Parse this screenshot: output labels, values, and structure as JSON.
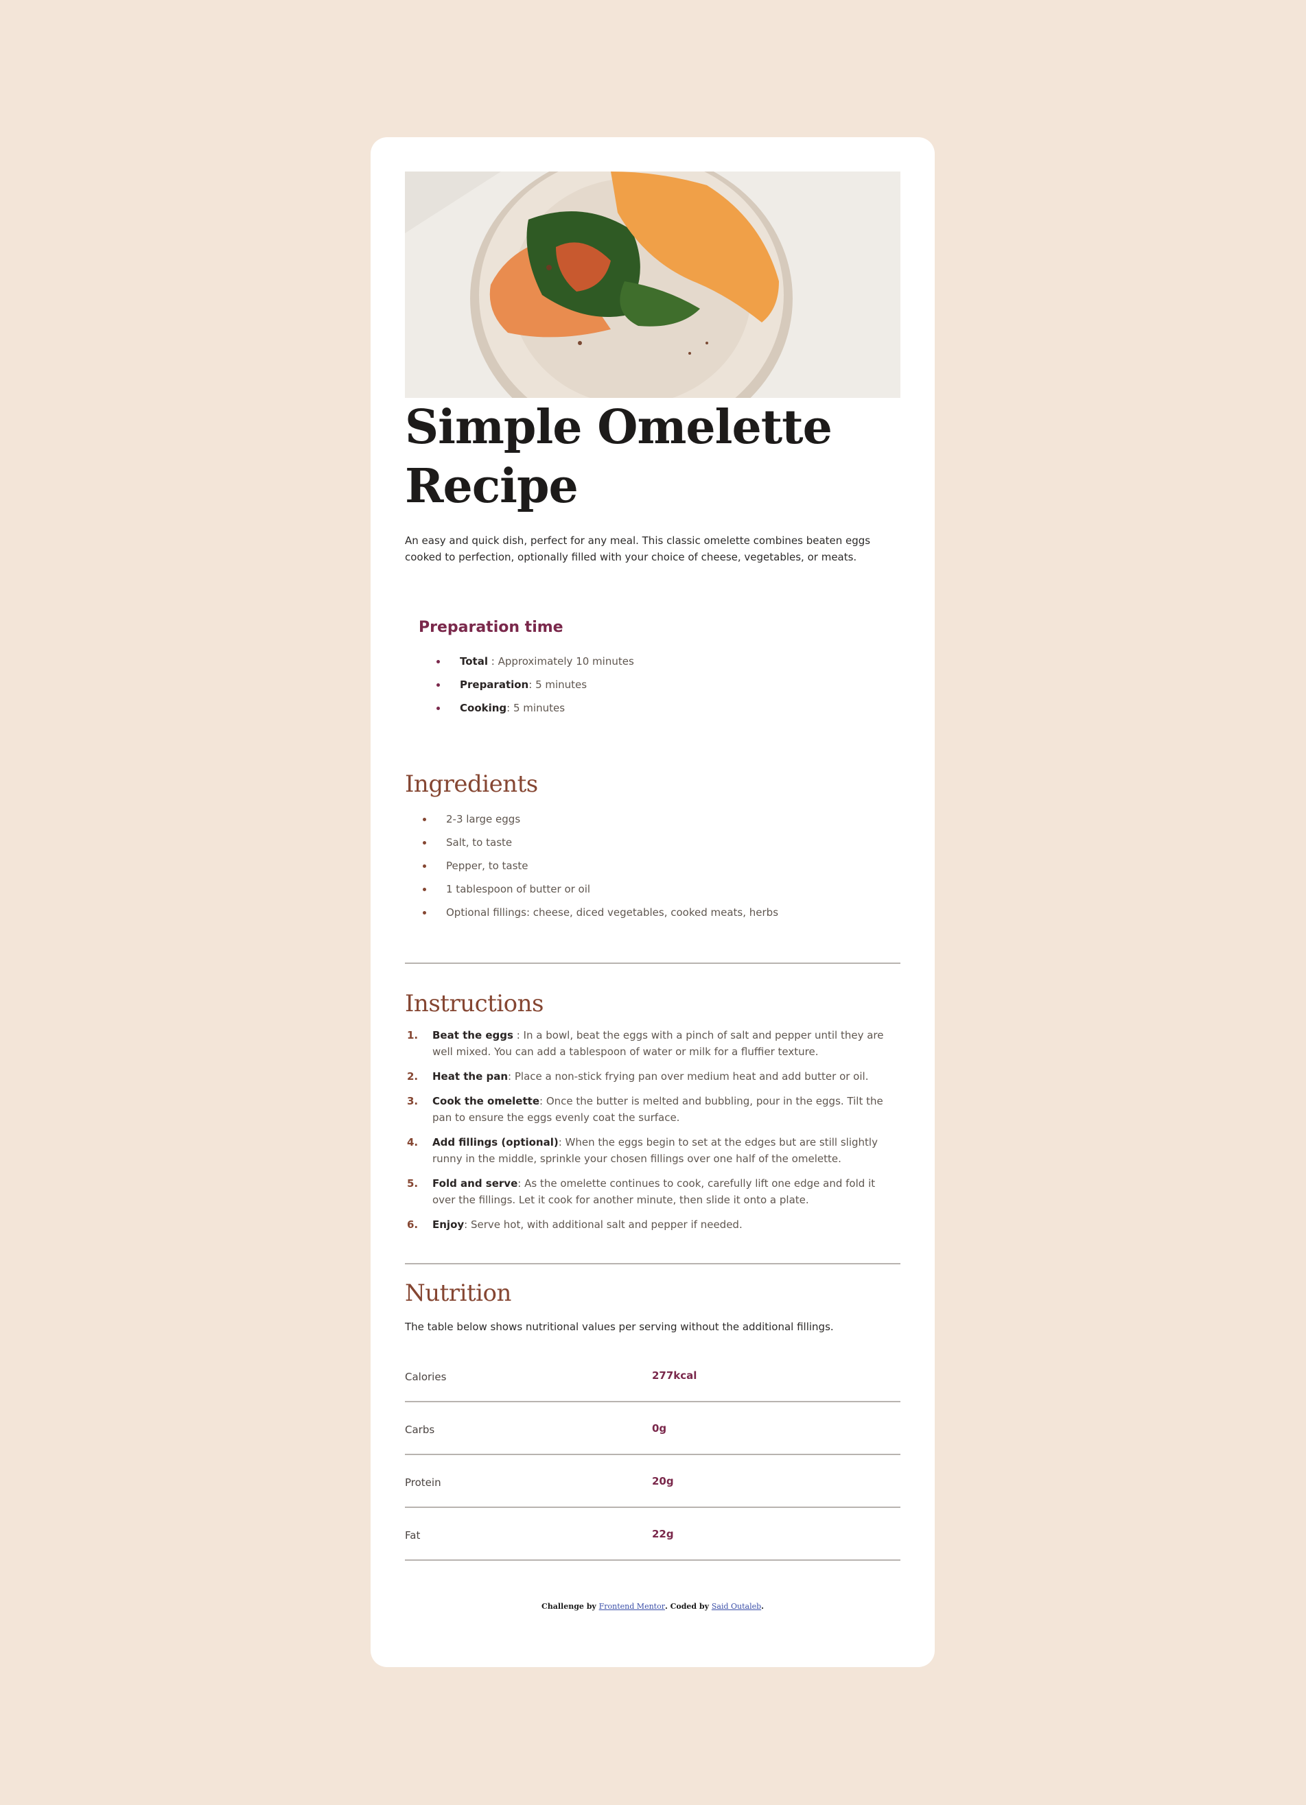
{
  "recipe": {
    "title": "Simple Omelette Recipe",
    "intro": "An easy and quick dish, perfect for any meal. This classic omelette combines beaten eggs cooked to perfection, optionally filled with your choice of cheese, vegetables, or meats."
  },
  "preparation": {
    "heading": "Preparation time",
    "items": [
      {
        "label": "Total",
        "value": " : Approximately 10 minutes"
      },
      {
        "label": "Preparation",
        "value": ": 5 minutes"
      },
      {
        "label": "Cooking",
        "value": ": 5 minutes"
      }
    ]
  },
  "ingredients": {
    "heading": "Ingredients",
    "items": [
      "2-3 large eggs",
      "Salt, to taste",
      "Pepper, to taste",
      "1 tablespoon of butter or oil",
      "Optional fillings: cheese, diced vegetables, cooked meats, herbs"
    ]
  },
  "instructions": {
    "heading": "Instructions",
    "steps": [
      {
        "num": "1.",
        "label": "Beat the eggs",
        "text": " : In a bowl, beat the eggs with a pinch of salt and pepper until they are well mixed. You can add a tablespoon of water or milk for a fluffier texture."
      },
      {
        "num": "2.",
        "label": "Heat the pan",
        "text": ": Place a non-stick frying pan over medium heat and add butter or oil."
      },
      {
        "num": "3.",
        "label": "Cook the omelette",
        "text": ": Once the butter is melted and bubbling, pour in the eggs. Tilt the pan to ensure the eggs evenly coat the surface."
      },
      {
        "num": "4.",
        "label": "Add fillings (optional)",
        "text": ": When the eggs begin to set at the edges but are still slightly runny in the middle, sprinkle your chosen fillings over one half of the omelette."
      },
      {
        "num": "5.",
        "label": "Fold and serve",
        "text": ": As the omelette continues to cook, carefully lift one edge and fold it over the fillings. Let it cook for another minute, then slide it onto a plate."
      },
      {
        "num": "6.",
        "label": "Enjoy",
        "text": ": Serve hot, with additional salt and pepper if needed."
      }
    ]
  },
  "nutrition": {
    "heading": "Nutrition",
    "description": "The table below shows nutritional values per serving without the additional fillings.",
    "rows": [
      {
        "name": "Calories",
        "value": "277kcal"
      },
      {
        "name": "Carbs",
        "value": "0g"
      },
      {
        "name": "Protein",
        "value": "20g"
      },
      {
        "name": "Fat",
        "value": "22g"
      }
    ]
  },
  "footer": {
    "prefix": "Challenge by ",
    "link1": "Frontend Mentor",
    "middle": ". Coded by ",
    "link2": "Said Outaleb",
    "suffix": "."
  },
  "colors": {
    "background": "#f3e5d8",
    "accent_brown": "#854632",
    "accent_wine": "#7a284b"
  }
}
